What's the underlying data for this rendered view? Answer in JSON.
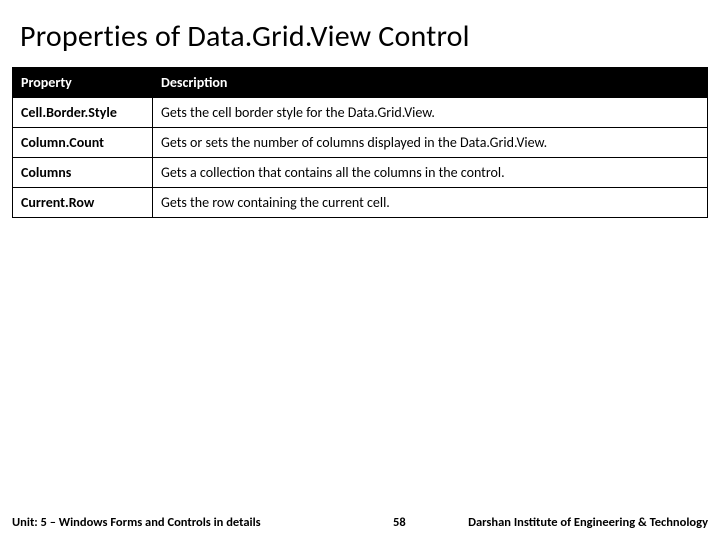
{
  "title": "Properties of Data.Grid.View Control",
  "table": {
    "headers": {
      "property": "Property",
      "description": "Description"
    },
    "rows": [
      {
        "property": "Cell.Border.Style",
        "description": "Gets the cell border style for the Data.Grid.View."
      },
      {
        "property": "Column.Count",
        "description": "Gets or sets the number of columns displayed in the Data.Grid.View."
      },
      {
        "property": "Columns",
        "description": "Gets a collection that contains all the columns in the control."
      },
      {
        "property": "Current.Row",
        "description": "Gets the row containing the current cell."
      }
    ]
  },
  "footer": {
    "left": "Unit: 5 – Windows Forms and Controls in details",
    "center": "58",
    "right": "Darshan Institute of Engineering & Technology"
  }
}
